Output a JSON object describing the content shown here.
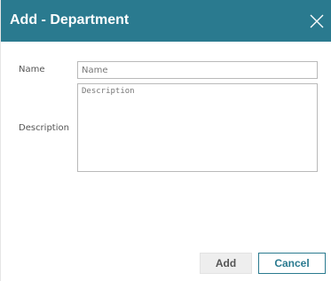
{
  "dialog": {
    "title": "Add - Department",
    "close_icon": "close-icon"
  },
  "form": {
    "name_label": "Name",
    "name_placeholder": "Name",
    "name_value": "",
    "description_label": "Description",
    "description_placeholder": "Description",
    "description_value": ""
  },
  "buttons": {
    "add_label": "Add",
    "cancel_label": "Cancel"
  },
  "colors": {
    "header_bg": "#2a7a8f",
    "accent": "#2a7a8f"
  }
}
